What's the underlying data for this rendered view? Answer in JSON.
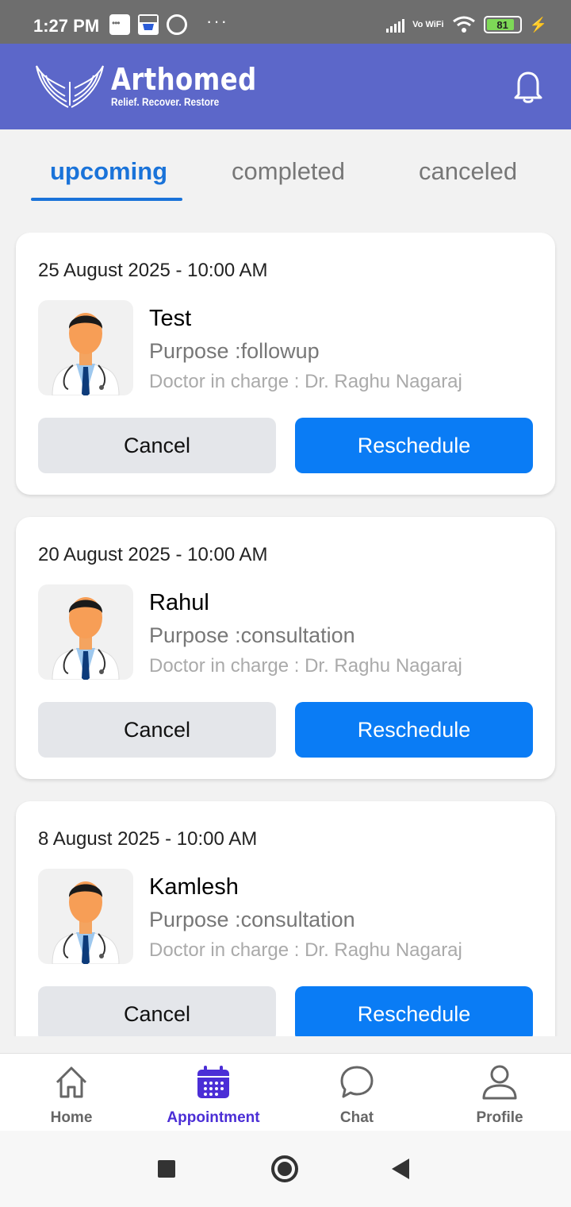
{
  "status_bar": {
    "time": "1:27 PM",
    "vowifi": "Vo WiFi",
    "battery": "81"
  },
  "header": {
    "brand_name": "Arthomed",
    "tagline": "Relief. Recover. Restore",
    "brand_color": "#5c67c9"
  },
  "tabs": [
    {
      "label": "upcoming",
      "active": true
    },
    {
      "label": "completed",
      "active": false
    },
    {
      "label": "canceled",
      "active": false
    }
  ],
  "appointments": [
    {
      "datetime": "25 August 2025 - 10:00 AM",
      "patient": "Test",
      "purpose": "Purpose :followup",
      "doctor": "Doctor in charge : Dr. Raghu Nagaraj",
      "cancel_label": "Cancel",
      "reschedule_label": "Reschedule"
    },
    {
      "datetime": "20 August 2025 - 10:00 AM",
      "patient": "Rahul",
      "purpose": "Purpose :consultation",
      "doctor": "Doctor in charge : Dr. Raghu Nagaraj",
      "cancel_label": "Cancel",
      "reschedule_label": "Reschedule"
    },
    {
      "datetime": "8 August 2025 - 10:00 AM",
      "patient": "Kamlesh",
      "purpose": "Purpose :consultation",
      "doctor": "Doctor in charge : Dr. Raghu Nagaraj",
      "cancel_label": "Cancel",
      "reschedule_label": "Reschedule"
    }
  ],
  "bottom_nav": [
    {
      "label": "Home",
      "icon": "home-icon",
      "active": false
    },
    {
      "label": "Appointment",
      "icon": "calendar-icon",
      "active": true
    },
    {
      "label": "Chat",
      "icon": "chat-icon",
      "active": false
    },
    {
      "label": "Profile",
      "icon": "person-icon",
      "active": false
    }
  ],
  "colors": {
    "accent": "#1a73d9",
    "primary_button": "#0a7cf5",
    "nav_active": "#4b2ed6"
  }
}
